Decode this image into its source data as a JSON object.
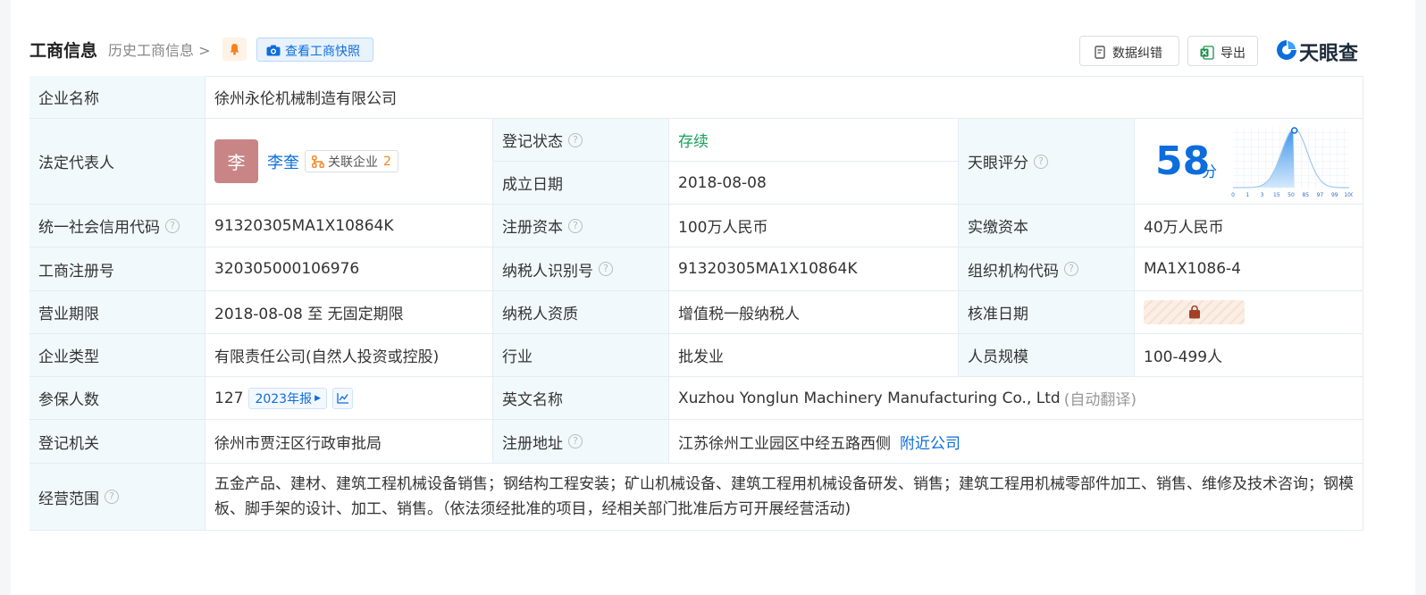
{
  "header": {
    "title": "工商信息",
    "history_link": "历史工商信息 >",
    "snapshot_button": "查看工商快照",
    "fix_button": "数据纠错",
    "export_button": "导出",
    "logo_text": "天眼查"
  },
  "rows": {
    "company_name_label": "企业名称",
    "company_name": "徐州永伦机械制造有限公司",
    "legal_rep_label": "法定代表人",
    "legal_rep_avatar": "李",
    "legal_rep_name": "李奎",
    "assoc_label": "关联企业",
    "assoc_count": "2",
    "reg_status_label": "登记状态",
    "reg_status": "存续",
    "founded_label": "成立日期",
    "founded": "2018-08-08",
    "score_label": "天眼评分",
    "score_value": "58",
    "score_unit": "分",
    "credit_code_label": "统一社会信用代码",
    "credit_code": "91320305MA1X10864K",
    "reg_capital_label": "注册资本",
    "reg_capital": "100万人民币",
    "paid_capital_label": "实缴资本",
    "paid_capital": "40万人民币",
    "reg_no_label": "工商注册号",
    "reg_no": "320305000106976",
    "taxpayer_id_label": "纳税人识别号",
    "taxpayer_id": "91320305MA1X10864K",
    "org_code_label": "组织机构代码",
    "org_code": "MA1X1086-4",
    "term_label": "营业期限",
    "term": "2018-08-08 至 无固定期限",
    "taxpayer_qual_label": "纳税人资质",
    "taxpayer_qual": "增值税一般纳税人",
    "approve_date_label": "核准日期",
    "type_label": "企业类型",
    "type": "有限责任公司(自然人投资或控股)",
    "industry_label": "行业",
    "industry": "批发业",
    "staff_label": "人员规模",
    "staff": "100-499人",
    "insured_label": "参保人数",
    "insured": "127",
    "insured_year": "2023年报",
    "english_name_label": "英文名称",
    "english_name": "Xuzhou Yonglun Machinery Manufacturing Co., Ltd",
    "auto_translate": "(自动翻译)",
    "authority_label": "登记机关",
    "authority": "徐州市贾汪区行政审批局",
    "address_label": "注册地址",
    "address": "江苏徐州工业园区中经五路西侧",
    "nearby_link": "附近公司",
    "scope_label": "经营范围",
    "scope": "五金产品、建材、建筑工程机械设备销售；钢结构工程安装；矿山机械设备、建筑工程用机械设备研发、销售；建筑工程用机械零部件加工、销售、维修及技术咨询；钢模板、脚手架的设计、加工、销售。（依法须经批准的项目，经相关部门批准后方可开展经营活动)"
  },
  "score_chart": {
    "tick_labels": [
      "0",
      "1",
      "3",
      "15",
      "50",
      "85",
      "97",
      "99",
      "100"
    ],
    "marker_value": 58
  },
  "colors": {
    "accent": "#0d6ddc",
    "label_bg": "#f2f9fc",
    "status_ok": "#19a05b",
    "orange": "#f5821f"
  }
}
